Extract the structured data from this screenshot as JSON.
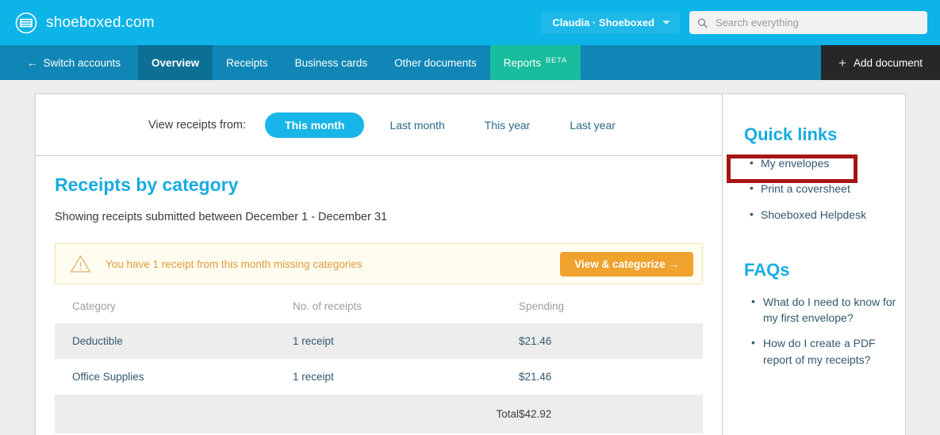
{
  "topbar": {
    "brand_name": "shoeboxed.com",
    "logo_icon": "shoebox-logo-icon",
    "account_label": "Claudia · Shoeboxed",
    "account_caret_icon": "chevron-down-icon",
    "search_icon": "search-icon",
    "search_value": "",
    "search_placeholder": "Search everything",
    "bg_color": "#0cb4e8"
  },
  "nav": {
    "bg_color": "#0f86b5",
    "active_color": "#0c6f96",
    "switch_accounts": {
      "label": "Switch accounts",
      "icon": "arrow-left-icon"
    },
    "items": [
      {
        "label": "Overview",
        "active": true
      },
      {
        "label": "Receipts",
        "active": false
      },
      {
        "label": "Business cards",
        "active": false
      },
      {
        "label": "Other documents",
        "active": false
      }
    ],
    "reports": {
      "label": "Reports",
      "badge": "BETA",
      "color": "#19bc9c"
    },
    "add_document": {
      "label": "Add document",
      "icon": "plus-icon",
      "bg_color": "#272727"
    }
  },
  "filter": {
    "label": "View receipts from:",
    "tabs": [
      {
        "label": "This month",
        "active": true
      },
      {
        "label": "Last month",
        "active": false
      },
      {
        "label": "This year",
        "active": false
      },
      {
        "label": "Last year",
        "active": false
      }
    ],
    "active_color": "#18b5e8"
  },
  "report": {
    "title": "Receipts by category",
    "subtitle": "Showing receipts submitted between December 1 - December 31",
    "warning": {
      "icon": "warning-triangle-icon",
      "text": "You have 1 receipt from this month missing categories",
      "button_label": "View & categorize →",
      "button_color": "#f0a22e",
      "bg_color": "#fffdf0"
    },
    "table": {
      "columns": [
        "Category",
        "No. of receipts",
        "Spending"
      ],
      "rows": [
        {
          "category": "Deductible",
          "receipts": "1 receipt",
          "spending": "$21.46"
        },
        {
          "category": "Office Supplies",
          "receipts": "1 receipt",
          "spending": "$21.46"
        }
      ],
      "total_label": "Total",
      "total_value": "$42.92"
    }
  },
  "sidebar": {
    "quick_links_title": "Quick links",
    "quick_links": [
      {
        "label": "My envelopes",
        "highlighted": true
      },
      {
        "label": "Print a coversheet",
        "highlighted": false
      },
      {
        "label": "Shoeboxed Helpdesk",
        "highlighted": false
      }
    ],
    "faqs_title": "FAQs",
    "faqs": [
      {
        "label": "What do I need to know for my first envelope?"
      },
      {
        "label": "How do I create a PDF report of my receipts?"
      }
    ],
    "highlight_color": "#a81414"
  }
}
